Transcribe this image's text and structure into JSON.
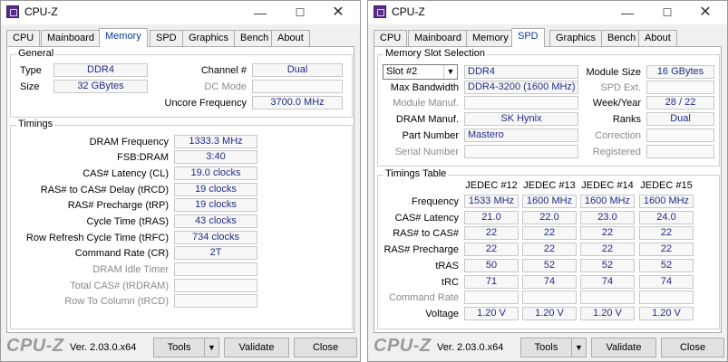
{
  "common": {
    "title": "CPU-Z",
    "brand": "CPU-Z",
    "version": "Ver. 2.03.0.x64",
    "tools": "Tools",
    "validate": "Validate",
    "close": "Close",
    "tabs": [
      "CPU",
      "Mainboard",
      "Memory",
      "SPD",
      "Graphics",
      "Bench",
      "About"
    ]
  },
  "memory": {
    "general": {
      "legend": "General",
      "type_label": "Type",
      "type": "DDR4",
      "size_label": "Size",
      "size": "32 GBytes",
      "channel_label": "Channel #",
      "channel": "Dual",
      "dcmode_label": "DC Mode",
      "dcmode": "",
      "uncore_label": "Uncore Frequency",
      "uncore": "3700.0 MHz"
    },
    "timings": {
      "legend": "Timings",
      "rows": [
        {
          "label": "DRAM Frequency",
          "value": "1333.3 MHz"
        },
        {
          "label": "FSB:DRAM",
          "value": "3:40"
        },
        {
          "label": "CAS# Latency (CL)",
          "value": "19.0 clocks"
        },
        {
          "label": "RAS# to CAS# Delay (tRCD)",
          "value": "19 clocks"
        },
        {
          "label": "RAS# Precharge (tRP)",
          "value": "19 clocks"
        },
        {
          "label": "Cycle Time (tRAS)",
          "value": "43 clocks"
        },
        {
          "label": "Row Refresh Cycle Time (tRFC)",
          "value": "734 clocks"
        },
        {
          "label": "Command Rate (CR)",
          "value": "2T"
        },
        {
          "label": "DRAM Idle Timer",
          "value": ""
        },
        {
          "label": "Total CAS# (tRDRAM)",
          "value": ""
        },
        {
          "label": "Row To Column (tRCD)",
          "value": ""
        }
      ]
    }
  },
  "spd": {
    "slot": {
      "legend": "Memory Slot Selection",
      "selected": "Slot #2",
      "type": "DDR4",
      "module_size_label": "Module Size",
      "module_size": "16 GBytes",
      "max_bw_label": "Max Bandwidth",
      "max_bw": "DDR4-3200 (1600 MHz)",
      "spd_ext_label": "SPD Ext.",
      "spd_ext": "",
      "module_manuf_label": "Module Manuf.",
      "module_manuf": "",
      "week_year_label": "Week/Year",
      "week_year": "28 / 22",
      "dram_manuf_label": "DRAM Manuf.",
      "dram_manuf": "SK Hynix",
      "ranks_label": "Ranks",
      "ranks": "Dual",
      "part_label": "Part Number",
      "part": "Mastero",
      "correction_label": "Correction",
      "correction": "",
      "serial_label": "Serial Number",
      "serial": "",
      "registered_label": "Registered",
      "registered": ""
    },
    "table": {
      "legend": "Timings Table",
      "headers": [
        "JEDEC #12",
        "JEDEC #13",
        "JEDEC #14",
        "JEDEC #15"
      ],
      "rows": [
        {
          "label": "Frequency",
          "values": [
            "1533 MHz",
            "1600 MHz",
            "1600 MHz",
            "1600 MHz"
          ]
        },
        {
          "label": "CAS# Latency",
          "values": [
            "21.0",
            "22.0",
            "23.0",
            "24.0"
          ]
        },
        {
          "label": "RAS# to CAS#",
          "values": [
            "22",
            "22",
            "22",
            "22"
          ]
        },
        {
          "label": "RAS# Precharge",
          "values": [
            "22",
            "22",
            "22",
            "22"
          ]
        },
        {
          "label": "tRAS",
          "values": [
            "50",
            "52",
            "52",
            "52"
          ]
        },
        {
          "label": "tRC",
          "values": [
            "71",
            "74",
            "74",
            "74"
          ]
        },
        {
          "label": "Command Rate",
          "values": [
            "",
            "",
            "",
            ""
          ]
        },
        {
          "label": "Voltage",
          "values": [
            "1.20 V",
            "1.20 V",
            "1.20 V",
            "1.20 V"
          ]
        }
      ]
    }
  },
  "icons": {
    "app": "cpu-z-app-icon",
    "minimize": "minimize-icon",
    "maximize": "maximize-icon",
    "close": "close-icon",
    "dropdown": "chevron-down-icon"
  }
}
